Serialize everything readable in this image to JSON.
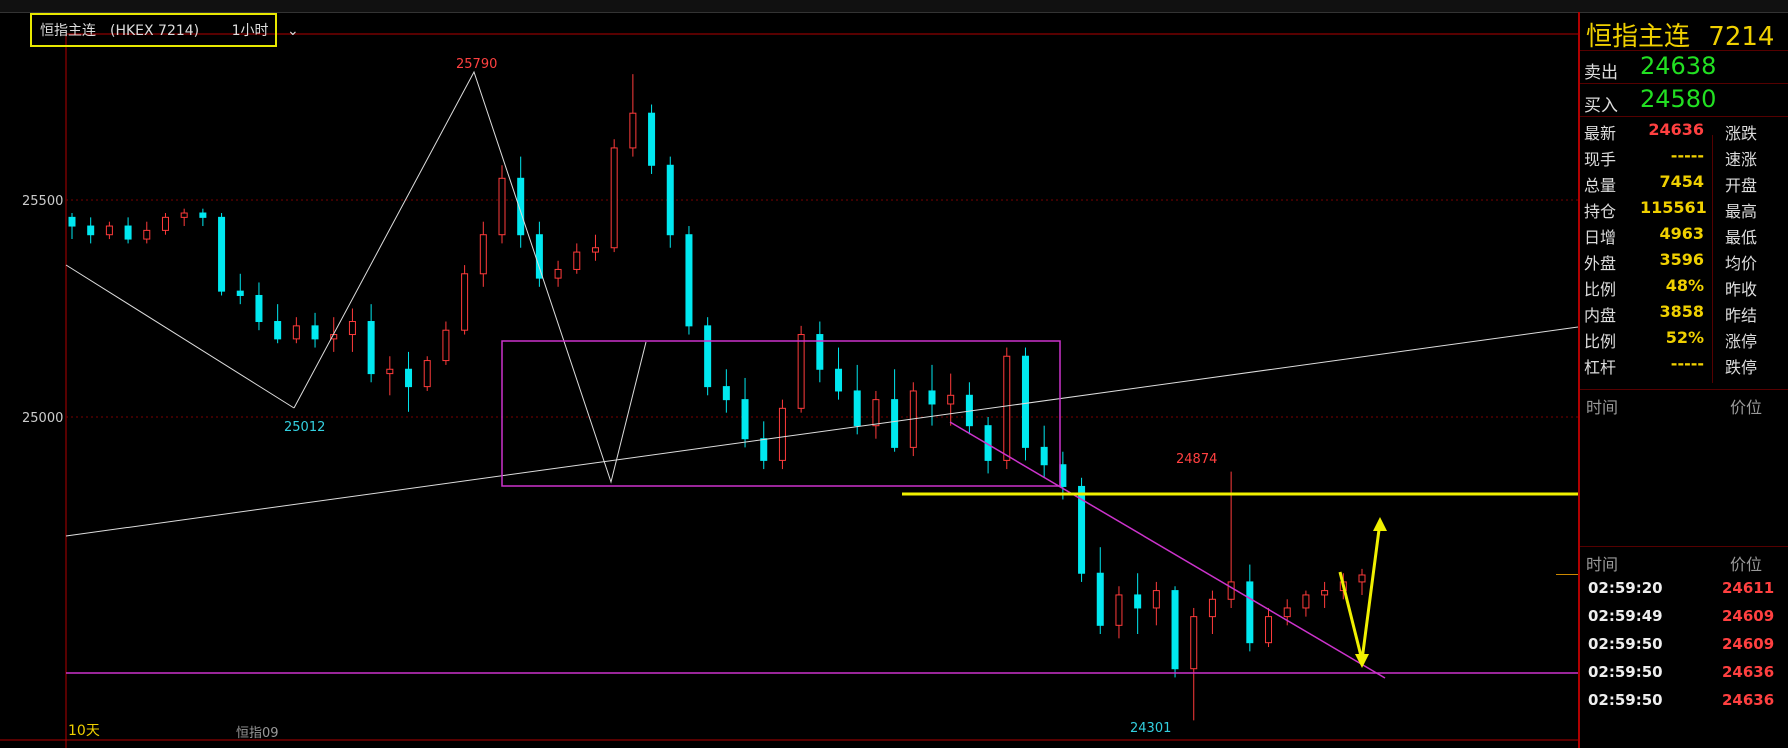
{
  "instrument": {
    "name": "恒指主连",
    "code": "(HKEX 7214)",
    "period": "1小时",
    "dropdown_icon": "chevron-down-icon"
  },
  "chart": {
    "y_ticks": [
      "25500",
      "25000"
    ],
    "annotations": {
      "high": "25790",
      "low_left": "25012",
      "mid_high": "24874",
      "low_right": "24301"
    },
    "bottom_label": "10天",
    "index_label": "恒指09"
  },
  "chart_data": {
    "type": "candlestick",
    "ytick_values": [
      25500,
      25000
    ],
    "ohlc_approx": [
      [
        25460,
        25470,
        25410,
        25440
      ],
      [
        25440,
        25460,
        25400,
        25420
      ],
      [
        25420,
        25450,
        25410,
        25440
      ],
      [
        25440,
        25460,
        25400,
        25410
      ],
      [
        25410,
        25450,
        25400,
        25430
      ],
      [
        25430,
        25470,
        25420,
        25460
      ],
      [
        25460,
        25480,
        25440,
        25470
      ],
      [
        25470,
        25480,
        25440,
        25460
      ],
      [
        25460,
        25470,
        25280,
        25290
      ],
      [
        25290,
        25330,
        25260,
        25280
      ],
      [
        25280,
        25310,
        25200,
        25220
      ],
      [
        25220,
        25260,
        25170,
        25180
      ],
      [
        25180,
        25230,
        25170,
        25210
      ],
      [
        25210,
        25240,
        25160,
        25180
      ],
      [
        25180,
        25230,
        25150,
        25190
      ],
      [
        25190,
        25250,
        25150,
        25220
      ],
      [
        25220,
        25260,
        25080,
        25100
      ],
      [
        25100,
        25140,
        25050,
        25110
      ],
      [
        25110,
        25150,
        25012,
        25070
      ],
      [
        25070,
        25140,
        25060,
        25130
      ],
      [
        25130,
        25220,
        25120,
        25200
      ],
      [
        25200,
        25350,
        25190,
        25330
      ],
      [
        25330,
        25450,
        25300,
        25420
      ],
      [
        25420,
        25580,
        25400,
        25550
      ],
      [
        25550,
        25600,
        25390,
        25420
      ],
      [
        25420,
        25450,
        25300,
        25320
      ],
      [
        25320,
        25360,
        25300,
        25340
      ],
      [
        25340,
        25400,
        25330,
        25380
      ],
      [
        25380,
        25420,
        25360,
        25390
      ],
      [
        25390,
        25640,
        25380,
        25620
      ],
      [
        25620,
        25790,
        25600,
        25700
      ],
      [
        25700,
        25720,
        25560,
        25580
      ],
      [
        25580,
        25600,
        25390,
        25420
      ],
      [
        25420,
        25440,
        25190,
        25210
      ],
      [
        25210,
        25230,
        25050,
        25070
      ],
      [
        25070,
        25110,
        25010,
        25040
      ],
      [
        25040,
        25090,
        24930,
        24950
      ],
      [
        24950,
        24990,
        24880,
        24900
      ],
      [
        24900,
        25040,
        24880,
        25020
      ],
      [
        25020,
        25210,
        25010,
        25190
      ],
      [
        25190,
        25220,
        25080,
        25110
      ],
      [
        25110,
        25160,
        25040,
        25060
      ],
      [
        25060,
        25120,
        24960,
        24980
      ],
      [
        24980,
        25060,
        24950,
        25040
      ],
      [
        25040,
        25110,
        24920,
        24930
      ],
      [
        24930,
        25080,
        24910,
        25060
      ],
      [
        25060,
        25120,
        24980,
        25030
      ],
      [
        25030,
        25100,
        24980,
        25050
      ],
      [
        25050,
        25080,
        24960,
        24980
      ],
      [
        24980,
        25000,
        24870,
        24900
      ],
      [
        24900,
        25160,
        24880,
        25140
      ],
      [
        25140,
        25160,
        24900,
        24930
      ],
      [
        24930,
        24980,
        24860,
        24890
      ],
      [
        24890,
        24920,
        24810,
        24840
      ],
      [
        24840,
        24860,
        24620,
        24640
      ],
      [
        24640,
        24700,
        24500,
        24520
      ],
      [
        24520,
        24610,
        24490,
        24590
      ],
      [
        24590,
        24640,
        24500,
        24560
      ],
      [
        24560,
        24620,
        24520,
        24600
      ],
      [
        24600,
        24610,
        24400,
        24420
      ],
      [
        24420,
        24560,
        24301,
        24540
      ],
      [
        24540,
        24600,
        24500,
        24580
      ],
      [
        24580,
        24874,
        24560,
        24620
      ],
      [
        24620,
        24660,
        24460,
        24480
      ],
      [
        24480,
        24560,
        24470,
        24540
      ],
      [
        24540,
        24580,
        24520,
        24560
      ],
      [
        24560,
        24600,
        24540,
        24590
      ],
      [
        24590,
        24620,
        24560,
        24600
      ],
      [
        24600,
        24640,
        24580,
        24620
      ],
      [
        24620,
        24650,
        24590,
        24636
      ]
    ]
  },
  "panel": {
    "title": "恒指主连",
    "code": "7214",
    "ask_label": "卖出",
    "ask": "24638",
    "bid_label": "买入",
    "bid": "24580",
    "rows": [
      {
        "label": "最新",
        "value": "24636",
        "color": "#ff4040",
        "right": "涨跌"
      },
      {
        "label": "现手",
        "value": "-----",
        "color": "#f0d000",
        "right": "速涨"
      },
      {
        "label": "总量",
        "value": "7454",
        "color": "#f0d000",
        "right": "开盘"
      },
      {
        "label": "持仓",
        "value": "115561",
        "color": "#f0d000",
        "right": "最高"
      },
      {
        "label": "日增",
        "value": "4963",
        "color": "#f0d000",
        "right": "最低"
      },
      {
        "label": "外盘",
        "value": "3596",
        "color": "#f0d000",
        "right": "均价"
      },
      {
        "label": "比例",
        "value": "48%",
        "color": "#f0d000",
        "right": "昨收"
      },
      {
        "label": "内盘",
        "value": "3858",
        "color": "#f0d000",
        "right": "昨结"
      },
      {
        "label": "比例",
        "value": "52%",
        "color": "#f0d000",
        "right": "涨停"
      },
      {
        "label": "杠杆",
        "value": "-----",
        "color": "#f0d000",
        "right": "跌停"
      }
    ],
    "ticks_header_time": "时间",
    "ticks_header_price": "价位",
    "ticks": [
      {
        "time": "02:59:20",
        "price": "24611"
      },
      {
        "time": "02:59:49",
        "price": "24609"
      },
      {
        "time": "02:59:50",
        "price": "24609"
      },
      {
        "time": "02:59:50",
        "price": "24636"
      },
      {
        "time": "02:59:50",
        "price": "24636"
      }
    ]
  }
}
